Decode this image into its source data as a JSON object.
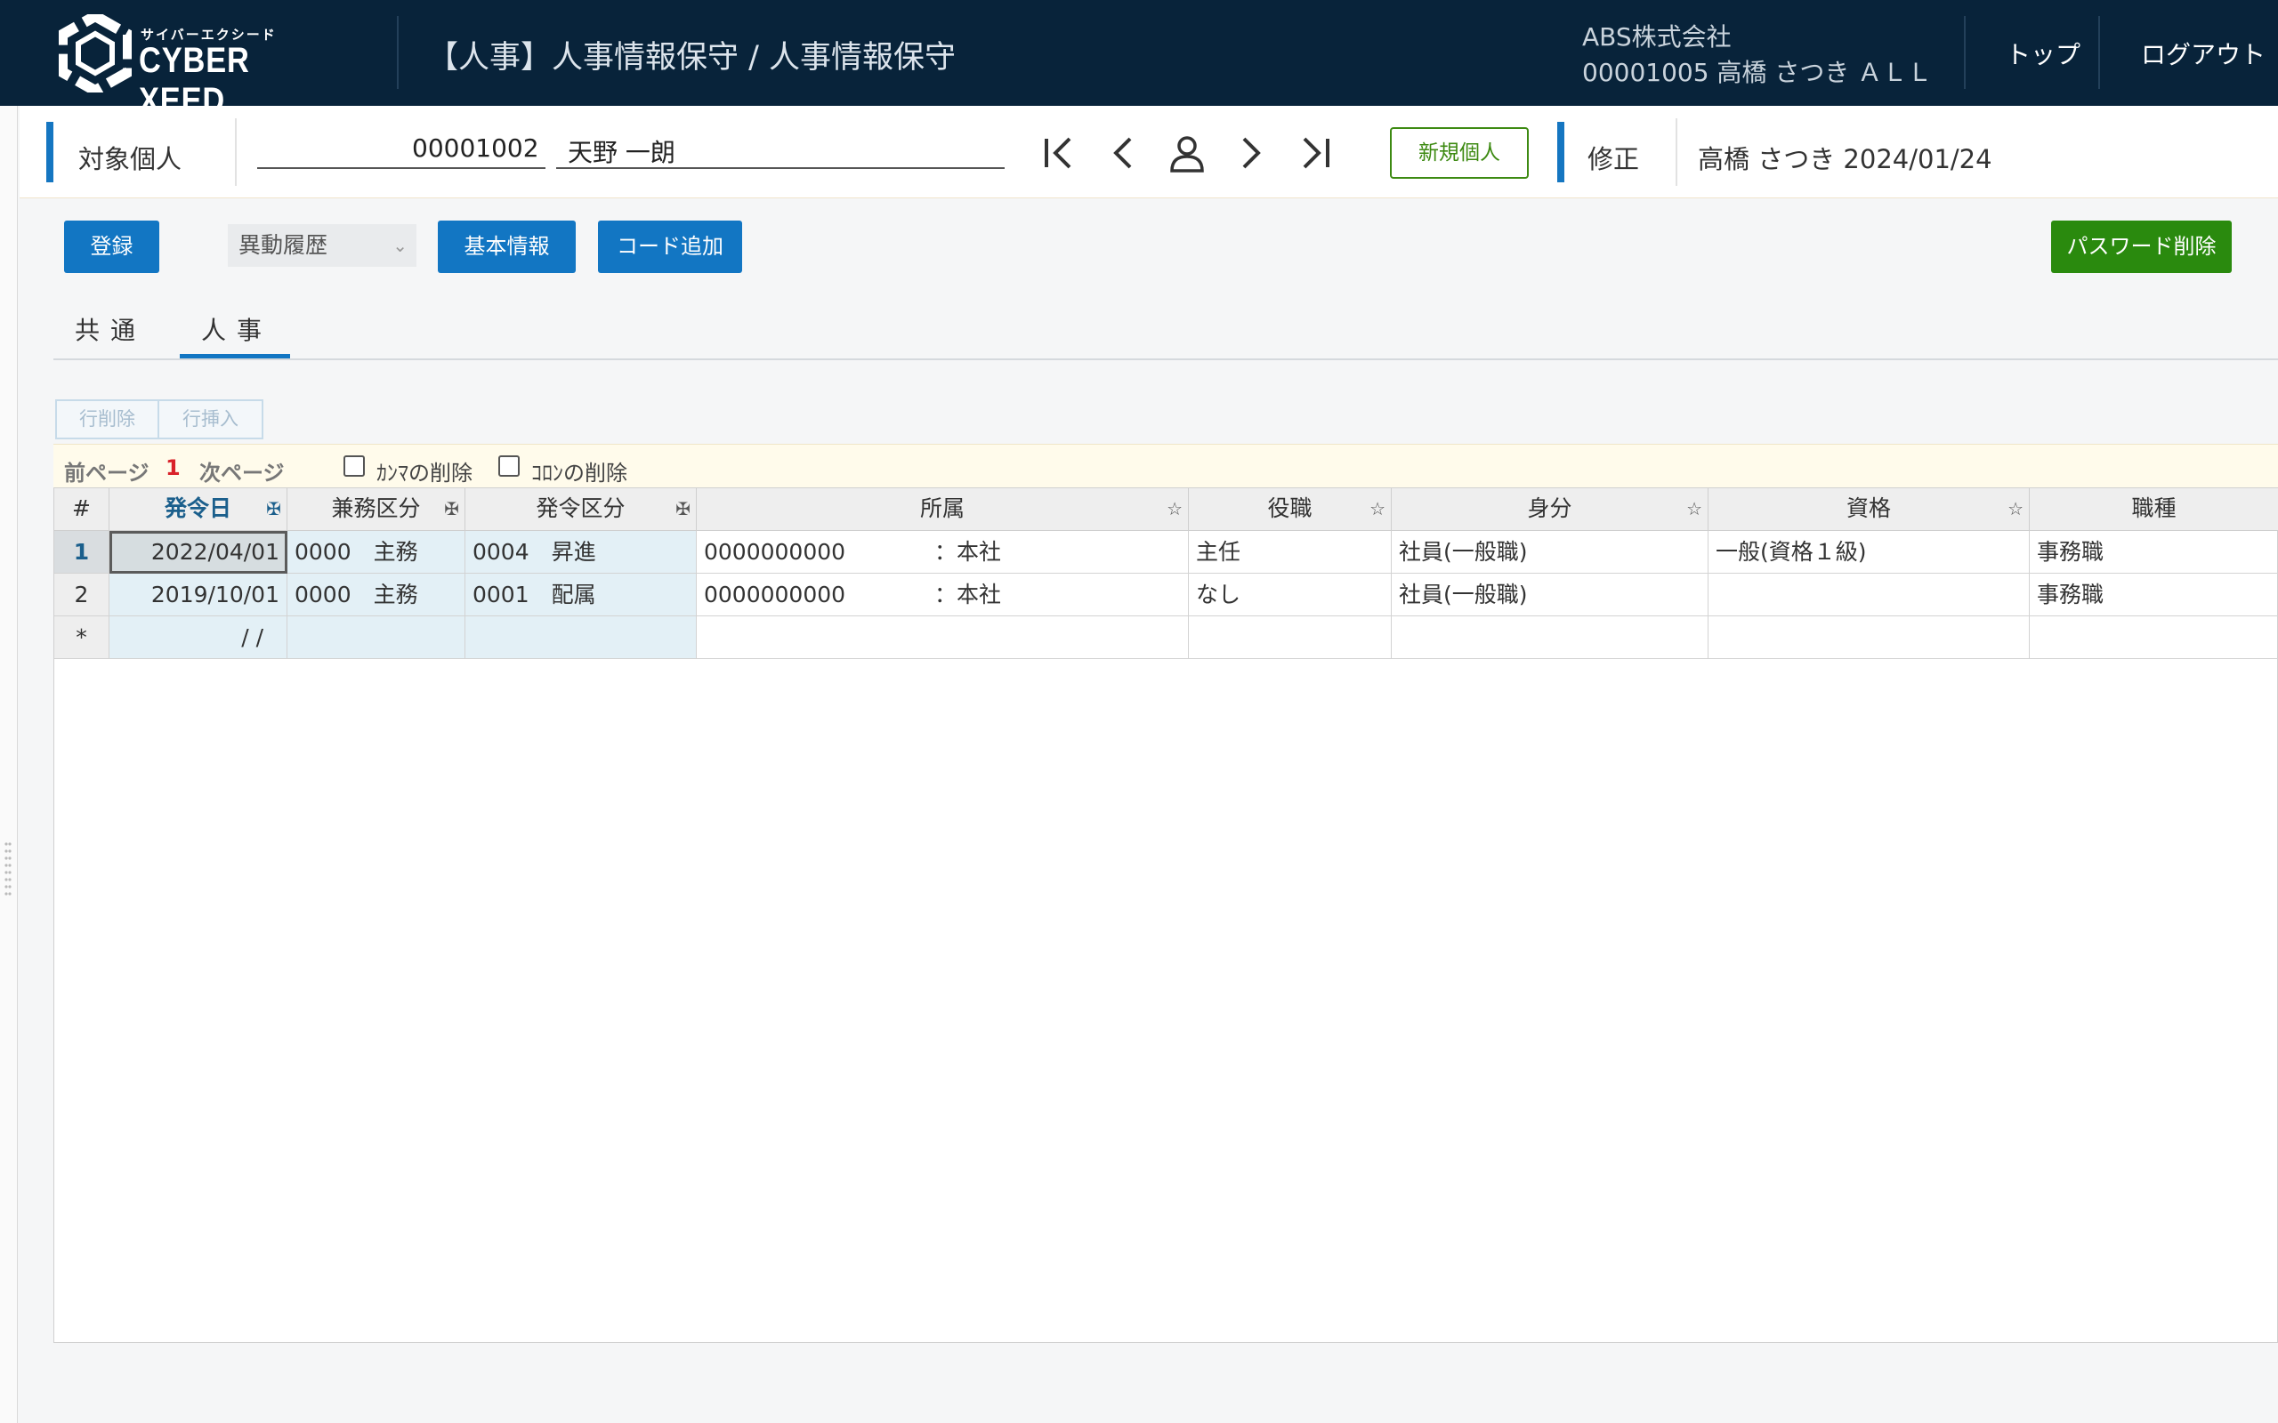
{
  "header": {
    "logo_kana": "サイバーエクシード",
    "logo_text": "CYBER XEED",
    "screen_title": "【人事】人事情報保守 / 人事情報保守",
    "company": "ABS株式会社",
    "user": "00001005 高橋 さつき ＡＬＬ",
    "top_label": "トップ",
    "logout_label": "ログアウト"
  },
  "person_bar": {
    "target_label": "対象個人",
    "employee_code": "00001002",
    "employee_name": "天野 一朗",
    "new_person_label": "新規個人",
    "mode_label": "修正",
    "modified_info": "高橋 さつき 2024/01/24"
  },
  "toolbar": {
    "register_label": "登録",
    "history_select": "異動履歴",
    "basic_info_label": "基本情報",
    "add_code_label": "コード追加",
    "delete_password_label": "パスワード削除"
  },
  "tabs": [
    {
      "label": "共通"
    },
    {
      "label": "人事"
    }
  ],
  "row_buttons": {
    "delete_row": "行削除",
    "insert_row": "行挿入"
  },
  "paging": {
    "prev": "前ページ",
    "page": "1",
    "next": "次ページ",
    "comma_delete": "ｶﾝﾏの削除",
    "colon_delete": "ｺﾛﾝの削除"
  },
  "grid": {
    "columns": [
      "#",
      "発令日",
      "兼務区分",
      "発令区分",
      "所属",
      "役職",
      "身分",
      "資格",
      "職種"
    ],
    "rows": [
      [
        "1",
        "2022/04/01",
        "0000　主務",
        "0004　昇進",
        "0000000000　　　　：本社",
        "主任",
        "社員(一般職)",
        "一般(資格１級)",
        "事務職"
      ],
      [
        "2",
        "2019/10/01",
        "0000　主務",
        "0001　配属",
        "0000000000　　　　：本社",
        "なし",
        "社員(一般職)",
        "",
        "事務職"
      ],
      [
        "*",
        "/  /",
        "",
        "",
        "",
        "",
        "",
        "",
        ""
      ]
    ]
  },
  "colors": {
    "header_bg": "#08233a",
    "primary_button": "#1276c3",
    "green_button": "#2a8a0e",
    "accent_bar": "#1576c1"
  }
}
